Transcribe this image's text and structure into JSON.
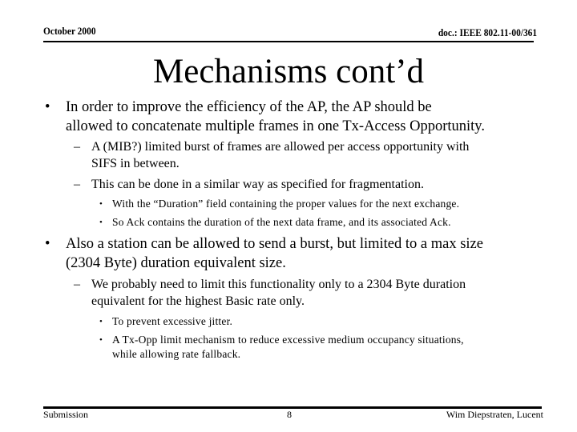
{
  "header": {
    "date": "October 2000",
    "doc_id": "doc.: IEEE 802.11-00/361"
  },
  "title": "Mechanisms cont’d",
  "bullets": [
    {
      "level": 1,
      "text": "In order to improve the efficiency of the AP, the AP should be allowed to concatenate multiple frames in one Tx-Access Opportunity.",
      "line1": "In order to improve the efficiency of the AP, the AP should be",
      "line2": "allowed to concatenate multiple frames in one Tx-Access Opportunity."
    },
    {
      "level": 2,
      "line1": "A (MIB?) limited burst of frames are allowed per access opportunity with",
      "line2": "SIFS in between."
    },
    {
      "level": 2,
      "line1": "This can be done in a similar way as specified for fragmentation."
    },
    {
      "level": 3,
      "line1": "With the “Duration” field containing the proper values for the next exchange."
    },
    {
      "level": 3,
      "line1": "So Ack contains the duration of the next data frame, and its associated Ack."
    },
    {
      "level": 1,
      "line1": "Also a station can be allowed to send a burst, but limited to a max size",
      "line2": "(2304 Byte) duration equivalent size."
    },
    {
      "level": 2,
      "line1": "We probably need to limit this functionality only to a 2304 Byte duration",
      "line2": "equivalent for the highest Basic rate only."
    },
    {
      "level": 3,
      "line1": "To prevent excessive jitter."
    },
    {
      "level": 3,
      "line1": "A Tx-Opp limit mechanism to reduce excessive medium occupancy situations,",
      "line2": "while allowing rate fallback."
    }
  ],
  "markers": {
    "level1": "•",
    "level2": "–",
    "level3": "•"
  },
  "footer": {
    "left": "Submission",
    "page": "8",
    "right": "Wim Diepstraten, Lucent"
  }
}
